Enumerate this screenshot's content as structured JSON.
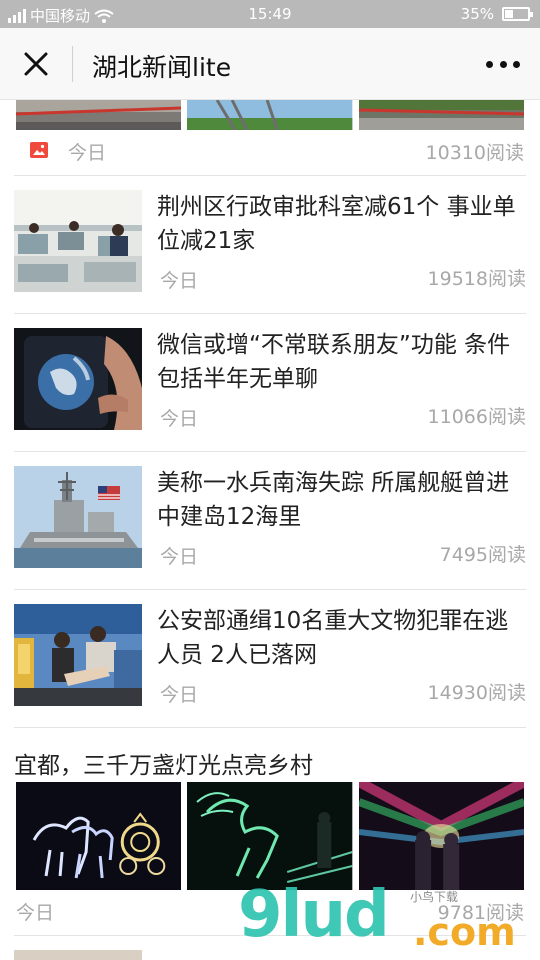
{
  "status_bar": {
    "carrier": "中国移动",
    "time": "15:49",
    "battery": "35%",
    "battery_level": 0.35
  },
  "title_bar": {
    "title": "湖北新闻lite",
    "close_icon": "close-icon",
    "more_icon": "more-dots-icon"
  },
  "feed": {
    "top_item": {
      "date": "今日",
      "reads": "10310阅读",
      "type_icon": "image-gallery-icon",
      "type_icon_color": "#f04a3e"
    },
    "items": [
      {
        "title": "荆州区行政审批科室减61个 事业单位减21家",
        "date": "今日",
        "reads": "19518阅读"
      },
      {
        "title": "微信或增“不常联系朋友”功能 条件包括半年无单聊",
        "date": "今日",
        "reads": "11066阅读"
      },
      {
        "title": "美称一水兵南海失踪 所属舰艇曾进中建岛12海里",
        "date": "今日",
        "reads": "7495阅读"
      },
      {
        "title": "公安部通缉10名重大文物犯罪在逃人员 2人已落网",
        "date": "今日",
        "reads": "14930阅读"
      }
    ],
    "gallery": {
      "title": "宜都，三千万盏灯光点亮乡村",
      "date": "今日",
      "reads": "9781阅读"
    }
  },
  "watermark": {
    "brand": "9lud",
    "domain": ".com",
    "tagline": "小鸟下载"
  }
}
